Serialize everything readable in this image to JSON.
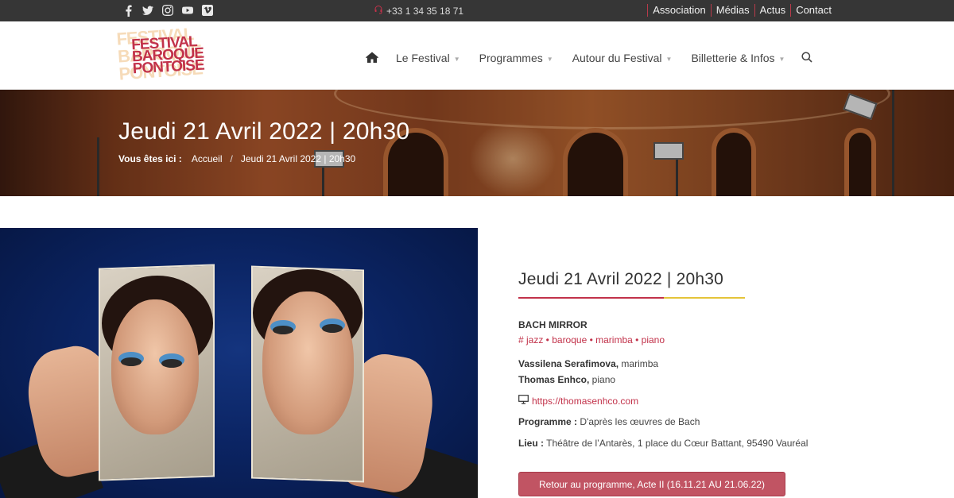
{
  "topbar": {
    "social_icons": [
      "facebook-icon",
      "twitter-icon",
      "instagram-icon",
      "youtube-icon",
      "vimeo-icon"
    ],
    "phone": "+33 1 34 35 18 71",
    "links": [
      "Association",
      "Médias",
      "Actus",
      "Contact"
    ]
  },
  "header": {
    "logo_lines": [
      "FESTIVAL",
      "BAROQUE",
      "PONTOISE"
    ],
    "nav": [
      "Le Festival",
      "Programmes",
      "Autour du Festival",
      "Billetterie & Infos"
    ]
  },
  "banner": {
    "title": "Jeudi 21 Avril 2022 | 20h30",
    "breadcrumb_label": "Vous êtes ici :",
    "breadcrumb_home": "Accueil",
    "breadcrumb_sep": "/",
    "breadcrumb_current": "Jeudi 21 Avril 2022 | 20h30"
  },
  "event": {
    "heading": "Jeudi 21 Avril 2022 | 20h30",
    "title": "BACH MIRROR",
    "tags": "# jazz • baroque • marimba • piano",
    "artist1_name": "Vassilena Serafimova,",
    "artist1_role": " marimba",
    "artist2_name": "Thomas Enhco,",
    "artist2_role": " piano",
    "website": "https://thomasenhco.com",
    "programme_label": "Programme :",
    "programme_value": " D'après les œuvres de Bach",
    "lieu_label": "Lieu :",
    "lieu_value": " Théâtre de l’Antarès, 1 place du Cœur Battant, 95490 Vauréal",
    "back_button": "Retour au programme, Acte II (16.11.21 AU 21.06.22)"
  },
  "colors": {
    "accent": "#c2324a",
    "accent_yellow": "#e5c43a",
    "topbar_bg": "#363636",
    "button_bg": "#c15463"
  }
}
